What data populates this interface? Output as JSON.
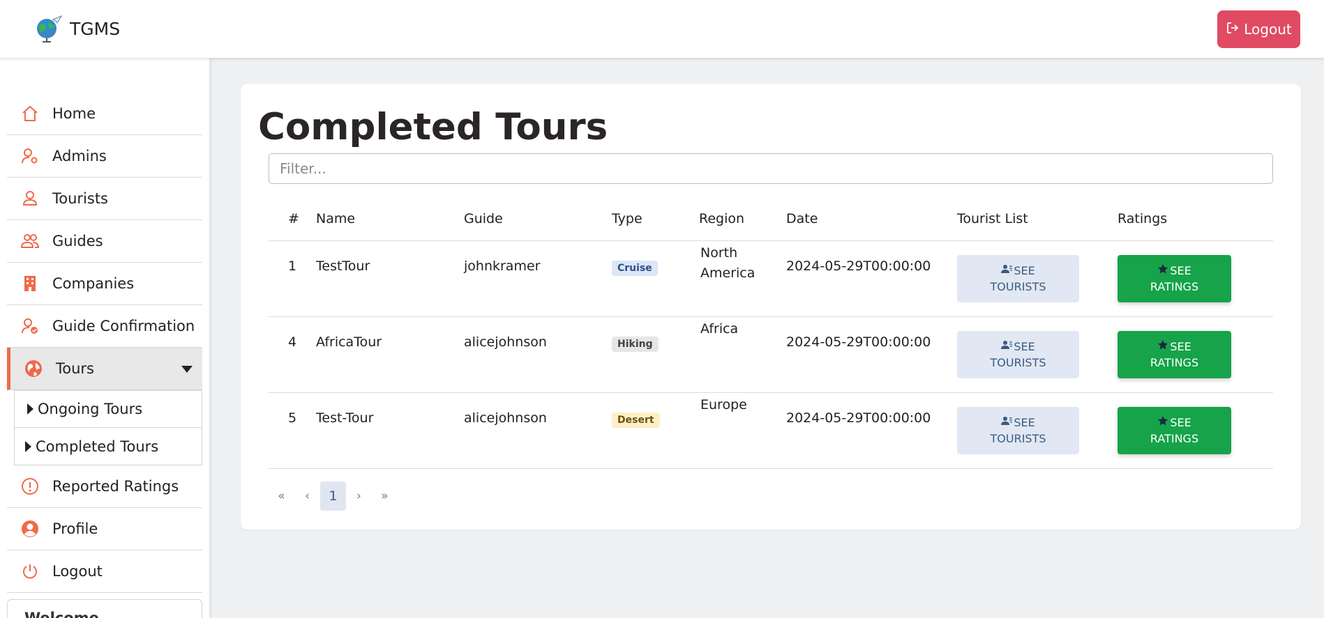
{
  "header": {
    "app_name": "TGMS",
    "logout_label": "Logout",
    "logo_icon": "globe-plane-icon"
  },
  "sidebar": {
    "accent_color": "#ef6a4a",
    "items": [
      {
        "label": "Home",
        "icon": "home-icon"
      },
      {
        "label": "Admins",
        "icon": "user-gear-icon"
      },
      {
        "label": "Tourists",
        "icon": "user-icon"
      },
      {
        "label": "Guides",
        "icon": "users-icon"
      },
      {
        "label": "Companies",
        "icon": "building-icon"
      },
      {
        "label": "Guide Confirmation",
        "icon": "user-check-icon"
      },
      {
        "label": "Tours",
        "icon": "globe-icon"
      }
    ],
    "sub_items": [
      {
        "label": "Ongoing Tours"
      },
      {
        "label": "Completed Tours"
      }
    ],
    "bottom_items": [
      {
        "label": "Reported Ratings",
        "icon": "exclamation-circle-icon"
      },
      {
        "label": "Profile",
        "icon": "user-circle-icon"
      },
      {
        "label": "Logout",
        "icon": "power-icon"
      }
    ],
    "welcome_text": "Welcome @burakcazli"
  },
  "main": {
    "title": "Completed Tours",
    "filter_placeholder": "Filter...",
    "columns": [
      "#",
      "Name",
      "Guide",
      "Type",
      "Region",
      "Date",
      "Tourist List",
      "Ratings"
    ],
    "rows": [
      {
        "id": "1",
        "name": "TestTour",
        "guide": "johnkramer",
        "type": "Cruise",
        "region_line1": "North",
        "region_line2": "America",
        "date": "2024-05-29T00:00:00"
      },
      {
        "id": "4",
        "name": "AfricaTour",
        "guide": "alicejohnson",
        "type": "Hiking",
        "region_line1": "Africa",
        "region_line2": "",
        "date": "2024-05-29T00:00:00"
      },
      {
        "id": "5",
        "name": "Test-Tour",
        "guide": "alicejohnson",
        "type": "Desert",
        "region_line1": "Europe",
        "region_line2": "",
        "date": "2024-05-29T00:00:00"
      }
    ],
    "see_tourists_line1": "SEE",
    "see_tourists_line2": "TOURISTS",
    "see_ratings_line1": "SEE",
    "see_ratings_line2": "RATINGS",
    "badge_colors": {
      "Cruise": {
        "bg": "#dbe7f7",
        "fg": "#2f4f8a"
      },
      "Hiking": {
        "bg": "#e6e6e6",
        "fg": "#444444"
      },
      "Desert": {
        "bg": "#fdf0c7",
        "fg": "#6b5210"
      }
    }
  },
  "pagination": {
    "first": "«",
    "prev": "‹",
    "current": "1",
    "next": "›",
    "last": "»"
  }
}
